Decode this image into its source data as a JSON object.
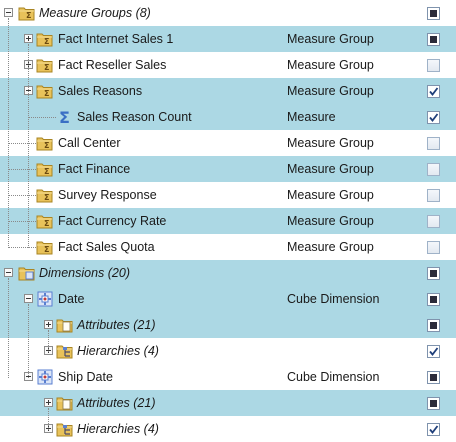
{
  "rows": [
    {
      "label": "Measure Groups (8)",
      "type": "",
      "level": 0,
      "icon": "measure-groups-folder-icon",
      "expander": "collapse",
      "check": "partial",
      "highlight": false,
      "italic": true
    },
    {
      "label": "Fact Internet Sales 1",
      "type": "Measure Group",
      "level": 1,
      "icon": "measure-group-folder-icon",
      "expander": "expand",
      "check": "partial",
      "highlight": true,
      "italic": false
    },
    {
      "label": "Fact Reseller Sales",
      "type": "Measure Group",
      "level": 1,
      "icon": "measure-group-folder-icon",
      "expander": "expand",
      "check": "unchecked",
      "highlight": false,
      "italic": false
    },
    {
      "label": "Sales Reasons",
      "type": "Measure Group",
      "level": 1,
      "icon": "measure-group-folder-icon",
      "expander": "collapse",
      "check": "checked",
      "highlight": true,
      "italic": false
    },
    {
      "label": "Sales Reason Count",
      "type": "Measure",
      "level": 2,
      "icon": "sigma-measure-icon",
      "expander": "none",
      "check": "checked",
      "highlight": true,
      "italic": false
    },
    {
      "label": "Call Center",
      "type": "Measure Group",
      "level": 1,
      "icon": "measure-group-folder-icon",
      "expander": "none",
      "check": "unchecked",
      "highlight": false,
      "italic": false
    },
    {
      "label": "Fact Finance",
      "type": "Measure Group",
      "level": 1,
      "icon": "measure-group-folder-icon",
      "expander": "none",
      "check": "unchecked",
      "highlight": true,
      "italic": false
    },
    {
      "label": "Survey Response",
      "type": "Measure Group",
      "level": 1,
      "icon": "measure-group-folder-icon",
      "expander": "none",
      "check": "unchecked",
      "highlight": false,
      "italic": false
    },
    {
      "label": "Fact Currency Rate",
      "type": "Measure Group",
      "level": 1,
      "icon": "measure-group-folder-icon",
      "expander": "none",
      "check": "unchecked",
      "highlight": true,
      "italic": false
    },
    {
      "label": "Fact Sales Quota",
      "type": "Measure Group",
      "level": 1,
      "icon": "measure-group-folder-icon",
      "expander": "none",
      "check": "unchecked",
      "highlight": false,
      "italic": false
    },
    {
      "label": "Dimensions (20)",
      "type": "",
      "level": 0,
      "icon": "dimensions-folder-icon",
      "expander": "collapse",
      "check": "partial",
      "highlight": true,
      "italic": true
    },
    {
      "label": "Date",
      "type": "Cube Dimension",
      "level": 1,
      "icon": "cube-dimension-icon",
      "expander": "collapse",
      "check": "partial",
      "highlight": true,
      "italic": false
    },
    {
      "label": "Attributes (21)",
      "type": "",
      "level": 2,
      "icon": "attributes-folder-icon",
      "expander": "expand",
      "check": "partial",
      "highlight": true,
      "italic": true
    },
    {
      "label": "Hierarchies (4)",
      "type": "",
      "level": 2,
      "icon": "hierarchies-folder-icon",
      "expander": "expand",
      "check": "checked",
      "highlight": false,
      "italic": true
    },
    {
      "label": "Ship Date",
      "type": "Cube Dimension",
      "level": 1,
      "icon": "cube-dimension-icon",
      "expander": "collapse",
      "check": "partial",
      "highlight": false,
      "italic": false
    },
    {
      "label": "Attributes (21)",
      "type": "",
      "level": 2,
      "icon": "attributes-folder-icon",
      "expander": "expand",
      "check": "partial",
      "highlight": true,
      "italic": true
    },
    {
      "label": "Hierarchies (4)",
      "type": "",
      "level": 2,
      "icon": "hierarchies-folder-icon",
      "expander": "expand",
      "check": "checked",
      "highlight": false,
      "italic": true
    }
  ],
  "colors": {
    "highlight": "#acd8e4",
    "folder": "#e8c25a",
    "sigma": "#3a6fc4",
    "cube": "#5a7fd0"
  }
}
